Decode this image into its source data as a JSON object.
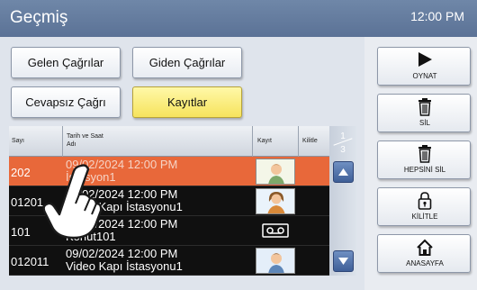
{
  "header": {
    "title": "Geçmiş",
    "clock": "12:00 PM"
  },
  "filters": {
    "incoming": "Gelen Çağrılar",
    "outgoing": "Giden Çağrılar",
    "missed": "Cevapsız Çağrı",
    "recordings": "Kayıtlar",
    "active": "recordings"
  },
  "table": {
    "headers": {
      "number": "Sayı",
      "datetime": "Tarih ve Saat",
      "name": "Adı",
      "record": "Kayıt",
      "lock": "Kilitle"
    },
    "rows": [
      {
        "number": "202",
        "datetime": "09/02/2024 12:00 PM",
        "name": "İstasyon1",
        "record": "photo-man-icon",
        "selected": true
      },
      {
        "number": "01201",
        "datetime": "09/02/2024 12:00 PM",
        "name": "Video Kapı İstasyonu1",
        "record": "photo-woman-icon",
        "selected": false
      },
      {
        "number": "101",
        "datetime": "09/02/2024 12:00 PM",
        "name": "Konut101",
        "record": "tape-icon",
        "selected": false
      },
      {
        "number": "012011",
        "datetime": "09/02/2024 12:00 PM",
        "name": "Video Kapı İstasyonu1",
        "record": "photo-man-icon",
        "selected": false
      }
    ]
  },
  "pager": {
    "current": "1",
    "total": "3"
  },
  "actions": {
    "play": "OYNAT",
    "delete": "SİL",
    "delete_all": "HEPSİNİ SİL",
    "lock": "KİLİTLE",
    "home": "ANASAYFA"
  },
  "colors": {
    "header": "#5f7698",
    "selected_row": "#e8683a",
    "active_filter": "#f6e35c",
    "table_bg": "#101010"
  }
}
